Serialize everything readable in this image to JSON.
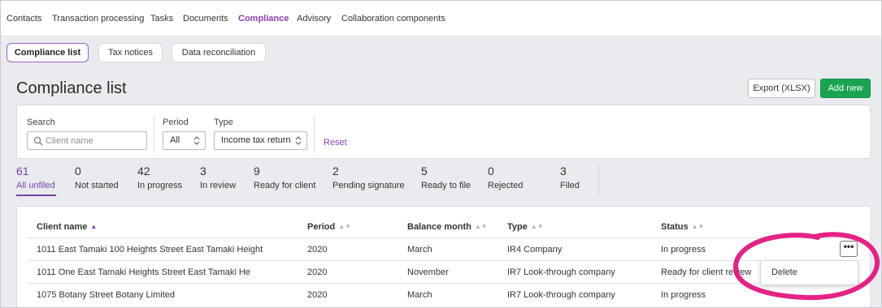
{
  "topnav": {
    "items": [
      {
        "label": "Contacts"
      },
      {
        "label": "Transaction processing"
      },
      {
        "label": "Tasks"
      },
      {
        "label": "Documents"
      },
      {
        "label": "Compliance",
        "active": true
      },
      {
        "label": "Advisory"
      },
      {
        "label": "Collaboration components"
      }
    ]
  },
  "subtabs": [
    {
      "label": "Compliance list",
      "active": true
    },
    {
      "label": "Tax notices"
    },
    {
      "label": "Data reconciliation"
    }
  ],
  "page": {
    "title": "Compliance list",
    "export_label": "Export (XLSX)",
    "add_label": "Add new"
  },
  "filters": {
    "search_label": "Search",
    "search_placeholder": "Client name",
    "period_label": "Period",
    "period_value": "All",
    "type_label": "Type",
    "type_value": "Income tax return",
    "reset_label": "Reset"
  },
  "counts": [
    {
      "num": "61",
      "label": "All unfiled",
      "active": true
    },
    {
      "num": "0",
      "label": "Not started"
    },
    {
      "num": "42",
      "label": "In progress"
    },
    {
      "num": "3",
      "label": "In review"
    },
    {
      "num": "9",
      "label": "Ready for client"
    },
    {
      "num": "2",
      "label": "Pending signature"
    },
    {
      "num": "5",
      "label": "Ready to file"
    },
    {
      "num": "0",
      "label": "Rejected"
    },
    {
      "num": "3",
      "label": "Filed"
    }
  ],
  "table": {
    "columns": [
      "Client name",
      "Period",
      "Balance month",
      "Type",
      "Status"
    ],
    "rows": [
      [
        "1011 East Tamaki 100 Heights Street East Tamaki Height",
        "2020",
        "March",
        "IR4 Company",
        "In progress"
      ],
      [
        "1011 One East Tamaki Heights Street East Tamaki He",
        "2020",
        "November",
        "IR7 Look-through company",
        "Ready for client review"
      ],
      [
        "1075 Botany Street Botany Limited",
        "2020",
        "March",
        "IR7 Look-through company",
        "In progress"
      ]
    ]
  },
  "row_menu": {
    "more_label": "•••",
    "delete_label": "Delete"
  },
  "colors": {
    "accent_purple": "#8a3fb5",
    "add_green": "#1aa452",
    "highlight_pink": "#e4167f"
  }
}
